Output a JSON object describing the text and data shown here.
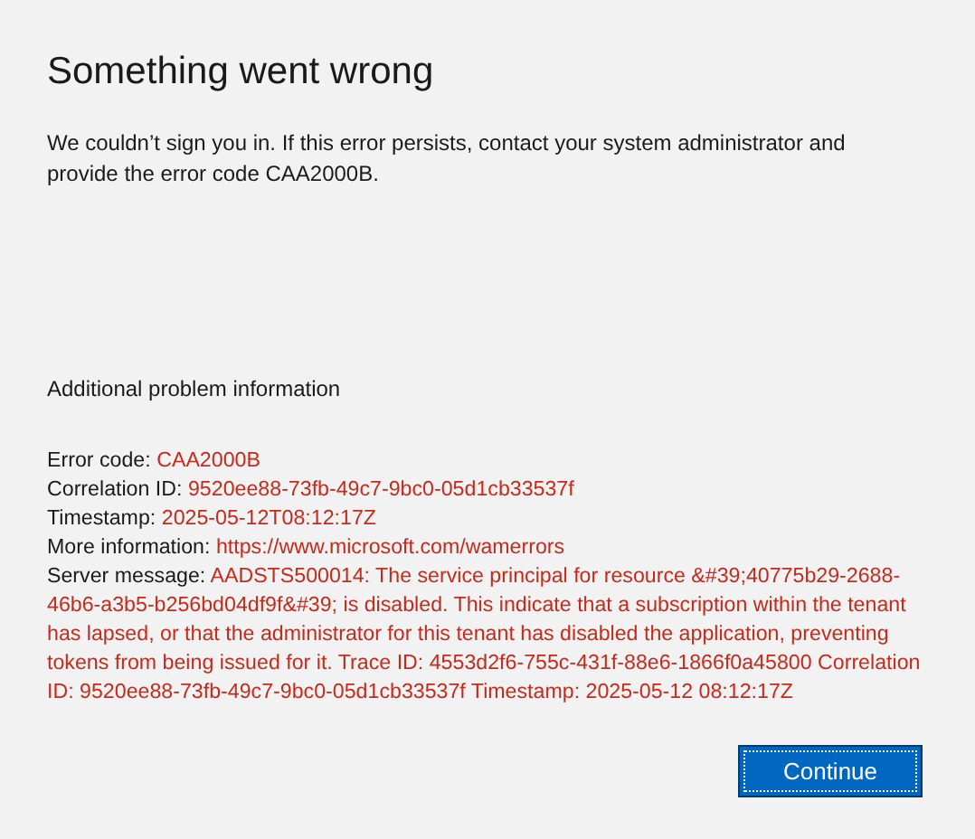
{
  "title": "Something went wrong",
  "message": "We couldn’t sign you in. If this error persists, contact your system administrator and provide the error code CAA2000B.",
  "section_heading": "Additional problem information",
  "details": [
    {
      "label": "Error code:",
      "value": "CAA2000B"
    },
    {
      "label": "Correlation ID:",
      "value": "9520ee88-73fb-49c7-9bc0-05d1cb33537f"
    },
    {
      "label": "Timestamp:",
      "value": "2025-05-12T08:12:17Z"
    },
    {
      "label": "More information:",
      "value": "https://www.microsoft.com/wamerrors"
    },
    {
      "label": "Server message:",
      "value": "AADSTS500014: The service principal for resource &#39;40775b29-2688-46b6-a3b5-b256bd04df9f&#39; is disabled. This indicate that a subscription within the tenant has lapsed, or that the administrator for this tenant has disabled the application, preventing tokens from being issued for it. Trace ID: 4553d2f6-755c-431f-88e6-1866f0a45800 Correlation ID: 9520ee88-73fb-49c7-9bc0-05d1cb33537f Timestamp: 2025-05-12 08:12:17Z"
    }
  ],
  "button": {
    "label": "Continue",
    "focused": true
  }
}
